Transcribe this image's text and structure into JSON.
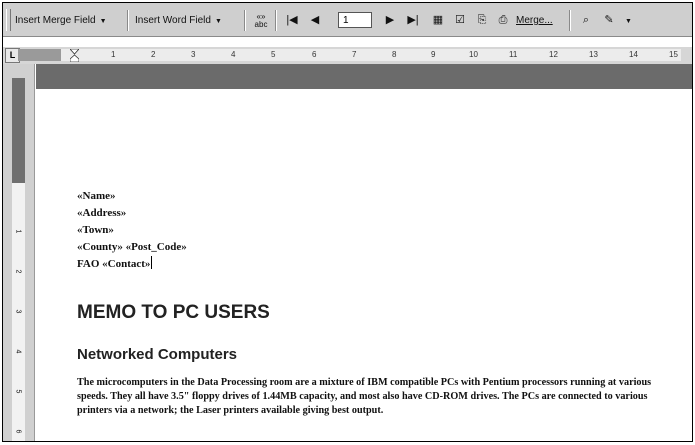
{
  "toolbar": {
    "insert_merge_field": "Insert Merge Field",
    "insert_word_field": "Insert Word Field",
    "view_merged_data_icon": "view-merged-data-icon",
    "record_number": "1",
    "merge_label": "Merge..."
  },
  "ruler": {
    "corner": "L",
    "ticks": [
      "1",
      "2",
      "3",
      "4",
      "5",
      "6",
      "7",
      "8",
      "9",
      "10",
      "11",
      "12",
      "13",
      "14",
      "15"
    ],
    "vticks": [
      "1",
      "2",
      "3",
      "4",
      "5",
      "6"
    ]
  },
  "document": {
    "merge_fields": [
      "«Name»",
      "«Address»",
      "«Town»",
      "«County» «Post_Code»",
      "FAO  «Contact»"
    ],
    "title": "MEMO TO PC USERS",
    "subtitle": "Networked Computers",
    "paragraph": "The microcomputers in the Data Processing room are a mixture of IBM compatible PCs with Pentium processors running at various speeds. They all have 3.5\" floppy drives of 1.44MB capacity, and most also have CD-ROM drives. The PCs are connected to various printers via a network; the Laser printers available giving best output."
  }
}
